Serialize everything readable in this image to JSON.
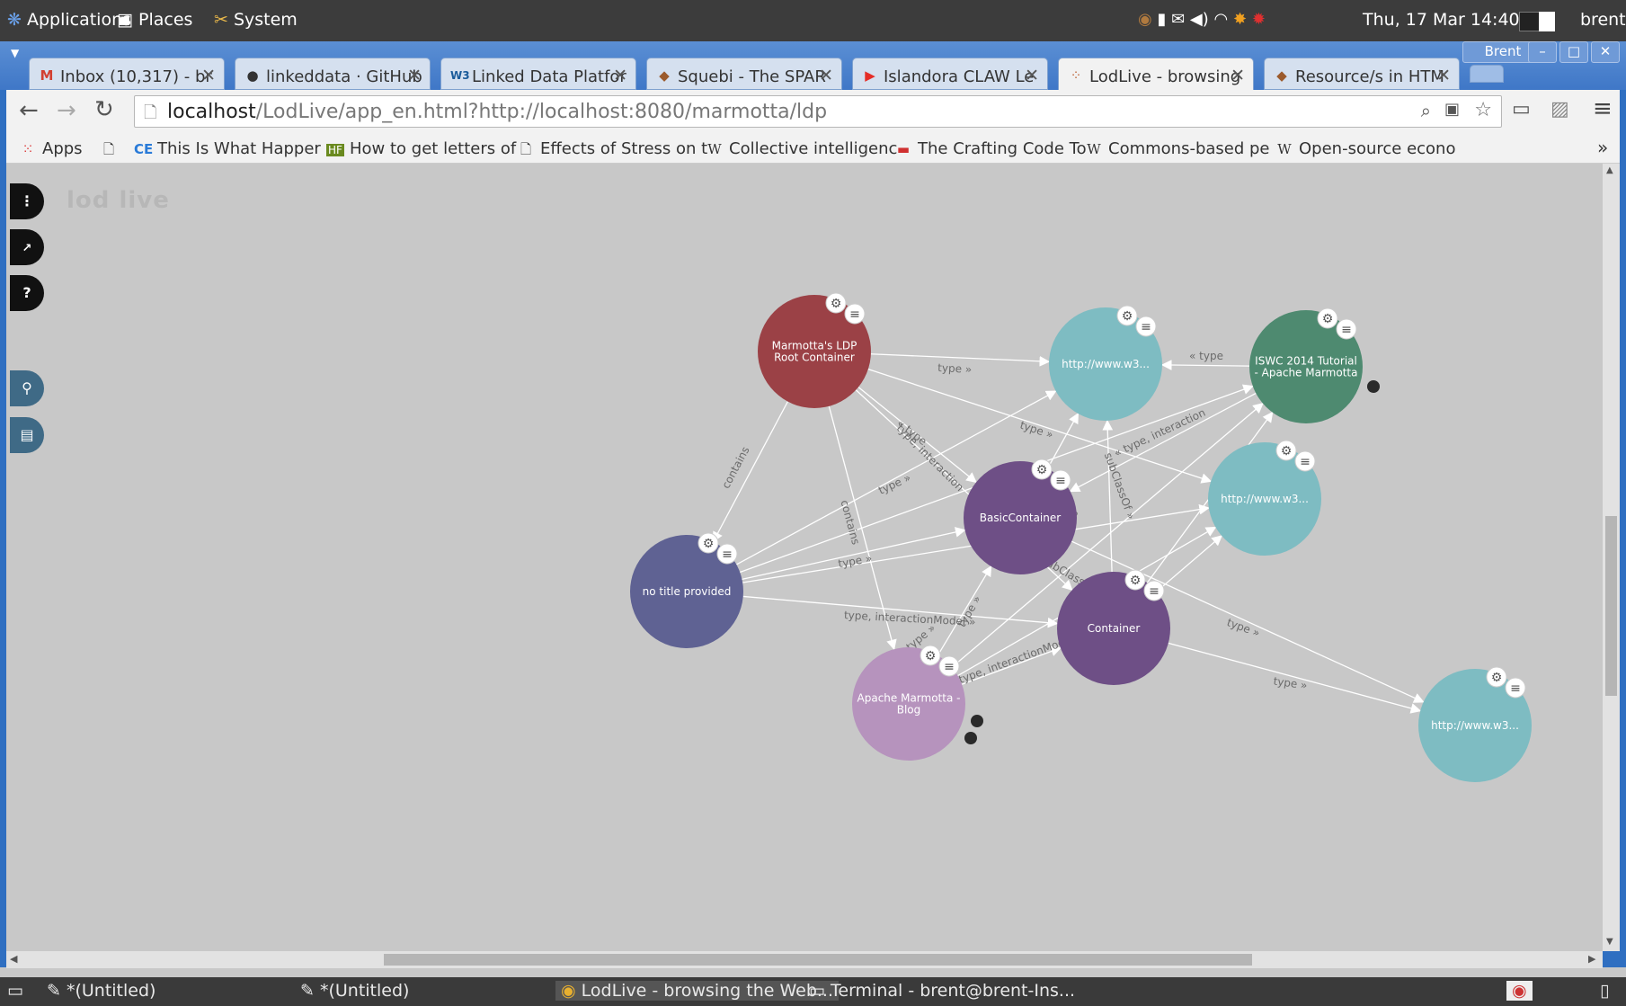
{
  "topbar": {
    "applications": "Applications",
    "places": "Places",
    "system": "System",
    "datetime": "Thu, 17 Mar 14:40",
    "user": "brent"
  },
  "window": {
    "profile": "Brent"
  },
  "tabs": [
    {
      "label": "Inbox (10,317) - br",
      "icon": "gmail-icon"
    },
    {
      "label": "linkeddata · GitHub",
      "icon": "github-icon"
    },
    {
      "label": "Linked Data Platfor",
      "icon": "w3c-icon"
    },
    {
      "label": "Squebi - The SPAR",
      "icon": "marmotta-icon"
    },
    {
      "label": "Islandora CLAW Le",
      "icon": "youtube-icon"
    },
    {
      "label": "LodLive - browsing",
      "icon": "lodlive-icon",
      "active": true
    },
    {
      "label": "Resource/s in HTM",
      "icon": "marmotta-icon"
    }
  ],
  "address": {
    "host": "localhost",
    "path": "/LodLive/app_en.html?http://localhost:8080/marmotta/ldp"
  },
  "bookmarks": [
    {
      "label": "Apps",
      "icon": "apps-grid-icon"
    },
    {
      "label": "",
      "icon": "page-icon"
    },
    {
      "label": "This Is What Happer",
      "icon": "ce-icon"
    },
    {
      "label": "How to get letters of",
      "icon": "hf-icon"
    },
    {
      "label": "Effects of Stress on t",
      "icon": "page-icon"
    },
    {
      "label": "Collective intelligenc",
      "icon": "wikipedia-icon"
    },
    {
      "label": "The Crafting Code To",
      "icon": "crafting-icon"
    },
    {
      "label": "Commons-based pe",
      "icon": "wikipedia-icon"
    },
    {
      "label": "Open-source econo",
      "icon": "wikipedia-icon"
    }
  ],
  "lodlive": {
    "logo": "lod live",
    "side_help": "?"
  },
  "graph": {
    "nodes": [
      {
        "id": "root",
        "label": [
          "Marmotta's LDP",
          "Root Container"
        ],
        "color": "#9b4146"
      },
      {
        "id": "w3a",
        "label": [
          "http://www.w3..."
        ],
        "color": "#7ebcc2"
      },
      {
        "id": "iswc",
        "label": [
          "ISWC 2014 Tutorial",
          "- Apache Marmotta"
        ],
        "color": "#4e8a70"
      },
      {
        "id": "w3b",
        "label": [
          "http://www.w3..."
        ],
        "color": "#7ebcc2"
      },
      {
        "id": "basic",
        "label": [
          "BasicContainer"
        ],
        "color": "#6e4f86"
      },
      {
        "id": "notitle",
        "label": [
          "no title provided"
        ],
        "color": "#5f6293"
      },
      {
        "id": "container",
        "label": [
          "Container"
        ],
        "color": "#6e4f86"
      },
      {
        "id": "blog",
        "label": [
          "Apache Marmotta -",
          "Blog"
        ],
        "color": "#b693bd"
      },
      {
        "id": "w3c",
        "label": [
          "http://www.w3..."
        ],
        "color": "#7ebcc2"
      }
    ],
    "edge_labels": [
      "type »",
      "« type",
      "type »",
      "« type",
      "contains",
      "contains",
      "type, interaction",
      "type »",
      "type »",
      "type, interactionModel »",
      "type »",
      "subClassOf »",
      "contains",
      "« type, interaction",
      "type »",
      "type »",
      "type, interactionModel",
      "type »",
      "type »",
      "subClassOf"
    ]
  },
  "taskbar": {
    "items": [
      "*(Untitled)",
      "*(Untitled)",
      "LodLive - browsing the Web...",
      "Terminal - brent@brent-Ins..."
    ]
  }
}
